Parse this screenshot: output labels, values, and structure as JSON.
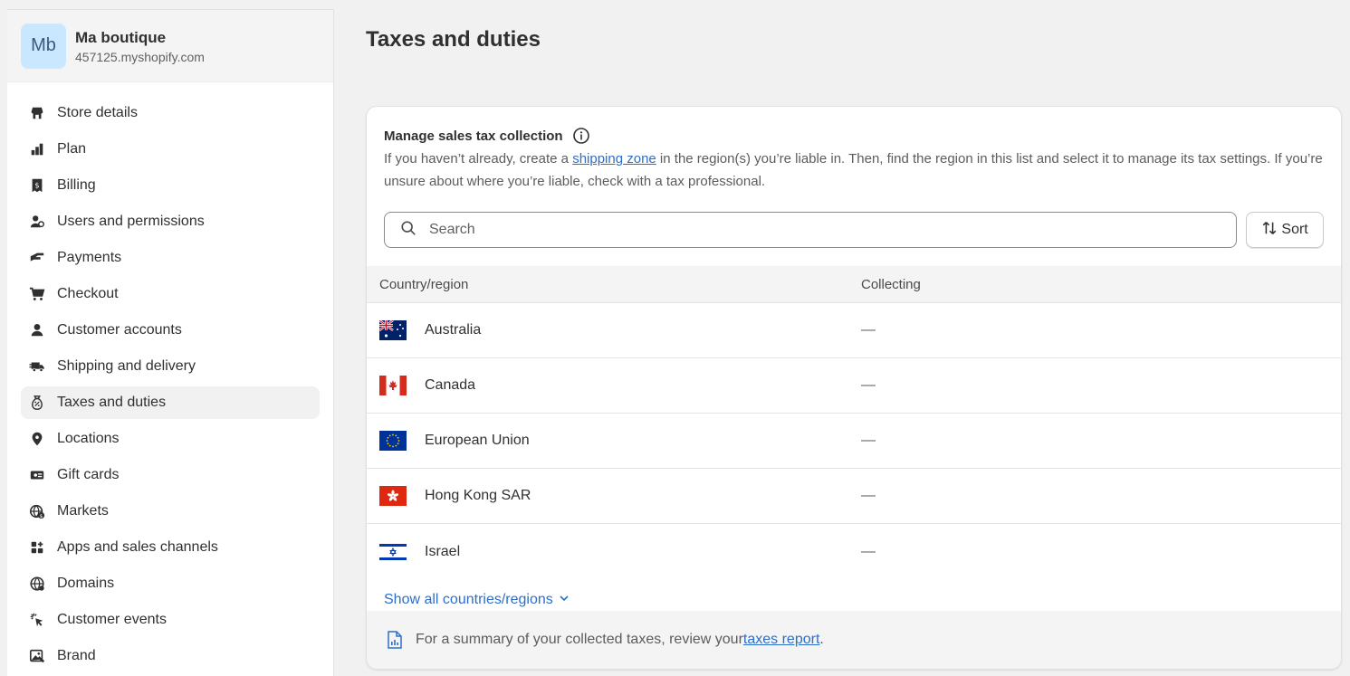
{
  "store": {
    "avatar_initials": "Mb",
    "name": "Ma boutique",
    "url": "457125.myshopify.com"
  },
  "sidebar": {
    "items": [
      {
        "label": "Store details",
        "icon": "store-icon"
      },
      {
        "label": "Plan",
        "icon": "plan-icon"
      },
      {
        "label": "Billing",
        "icon": "billing-icon"
      },
      {
        "label": "Users and permissions",
        "icon": "users-icon"
      },
      {
        "label": "Payments",
        "icon": "payments-icon"
      },
      {
        "label": "Checkout",
        "icon": "cart-icon"
      },
      {
        "label": "Customer accounts",
        "icon": "person-icon"
      },
      {
        "label": "Shipping and delivery",
        "icon": "truck-icon"
      },
      {
        "label": "Taxes and duties",
        "icon": "tax-icon",
        "active": true
      },
      {
        "label": "Locations",
        "icon": "location-icon"
      },
      {
        "label": "Gift cards",
        "icon": "gift-card-icon"
      },
      {
        "label": "Markets",
        "icon": "globe-dollar-icon"
      },
      {
        "label": "Apps and sales channels",
        "icon": "apps-icon"
      },
      {
        "label": "Domains",
        "icon": "globe-icon"
      },
      {
        "label": "Customer events",
        "icon": "cursor-icon"
      },
      {
        "label": "Brand",
        "icon": "brand-icon"
      }
    ]
  },
  "page": {
    "title": "Taxes and duties"
  },
  "card": {
    "title": "Manage sales tax collection",
    "desc_before": "If you haven’t already, create a ",
    "desc_link": "shipping zone",
    "desc_after": " in the region(s) you’re liable in. Then, find the region in this list and select it to manage its tax settings. If you’re unsure about where you’re liable, check with a tax professional.",
    "search_placeholder": "Search",
    "sort_label": "Sort",
    "columns": [
      "Country/region",
      "Collecting"
    ],
    "rows": [
      {
        "name": "Australia",
        "collecting": "—",
        "flag": "au"
      },
      {
        "name": "Canada",
        "collecting": "—",
        "flag": "ca"
      },
      {
        "name": "European Union",
        "collecting": "—",
        "flag": "eu"
      },
      {
        "name": "Hong Kong SAR",
        "collecting": "—",
        "flag": "hk"
      },
      {
        "name": "Israel",
        "collecting": "—",
        "flag": "il"
      }
    ],
    "show_all": "Show all countries/regions",
    "footer_before": "For a summary of your collected taxes, review your ",
    "footer_link": "taxes report",
    "footer_after": "."
  },
  "colors": {
    "link": "#2c6ecb",
    "avatar_bg": "#c9e7ff",
    "page_bg": "#f1f1f1"
  }
}
